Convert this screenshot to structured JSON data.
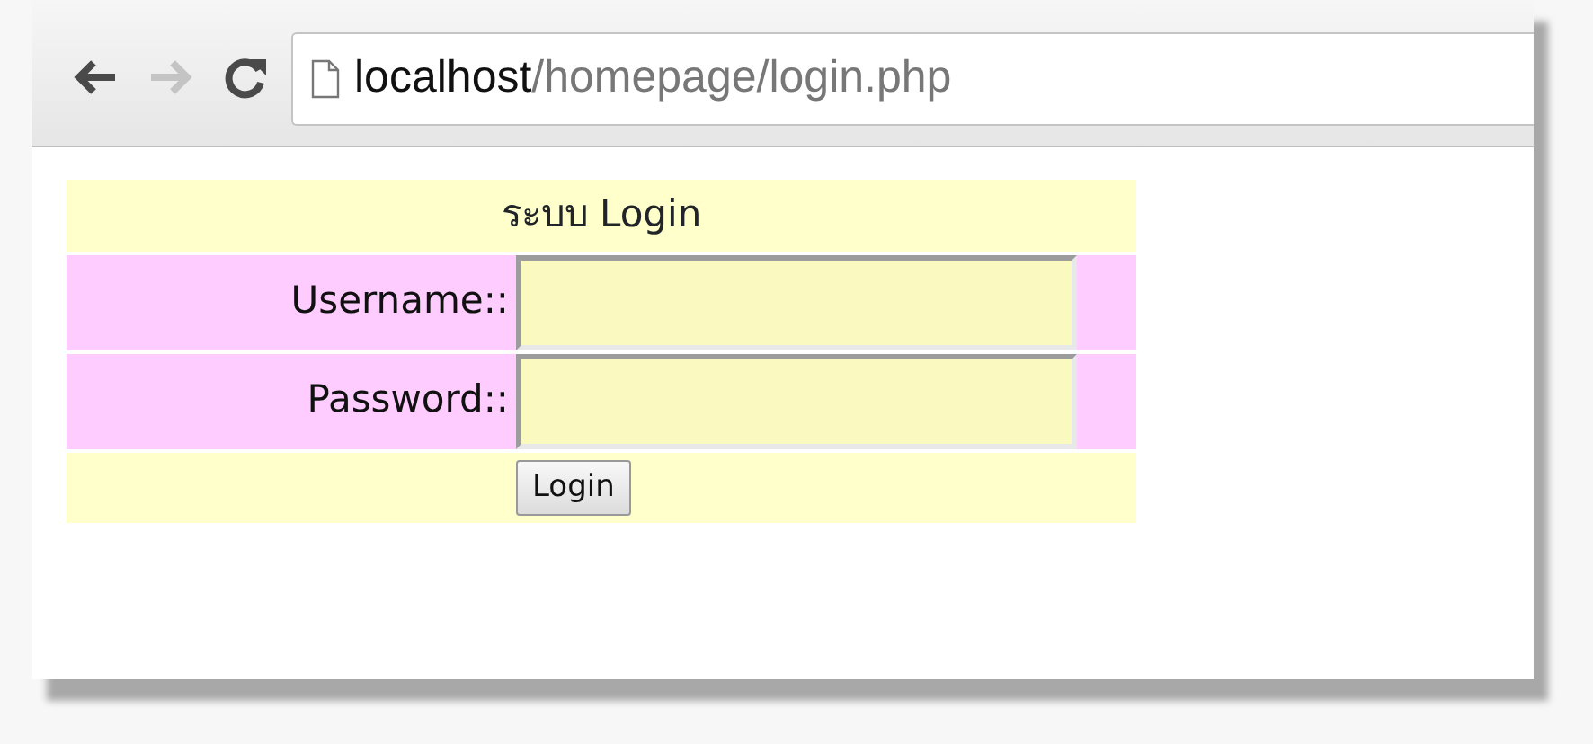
{
  "browser": {
    "nav_buttons": [
      {
        "kind": "back",
        "disabled": false
      },
      {
        "kind": "forward",
        "disabled": true
      },
      {
        "kind": "reload",
        "disabled": false
      }
    ],
    "address": {
      "host": "localhost",
      "path": "/homepage/login.php"
    }
  },
  "form": {
    "title": "ระบบ Login",
    "fields": [
      {
        "label": "Username::"
      },
      {
        "label": "Password::"
      }
    ],
    "button": "Login"
  }
}
